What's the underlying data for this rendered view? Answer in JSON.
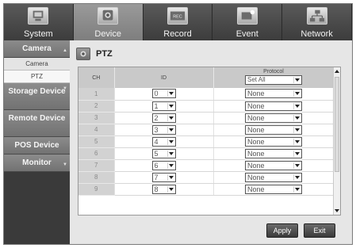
{
  "tabs": [
    {
      "label": "System",
      "icon": "system-icon",
      "active": false
    },
    {
      "label": "Device",
      "icon": "device-icon",
      "active": true
    },
    {
      "label": "Record",
      "icon": "record-icon",
      "active": false
    },
    {
      "label": "Event",
      "icon": "event-icon",
      "active": false
    },
    {
      "label": "Network",
      "icon": "network-icon",
      "active": false
    }
  ],
  "record_icon_text": "REC",
  "sidebar": {
    "camera": "Camera",
    "sub_camera": "Camera",
    "sub_ptz": "PTZ",
    "storage": "Storage Device",
    "remote": "Remote Device",
    "pos": "POS Device",
    "monitor": "Monitor"
  },
  "page": {
    "title": "PTZ",
    "title_icon": "ptz-camera-icon"
  },
  "table": {
    "headers": {
      "ch": "CH",
      "id": "ID",
      "protocol": "Protocol"
    },
    "protocol_all": "Set All",
    "rows": [
      {
        "ch": "1",
        "id": "0",
        "protocol": "None"
      },
      {
        "ch": "2",
        "id": "1",
        "protocol": "None"
      },
      {
        "ch": "3",
        "id": "2",
        "protocol": "None"
      },
      {
        "ch": "4",
        "id": "3",
        "protocol": "None"
      },
      {
        "ch": "5",
        "id": "4",
        "protocol": "None"
      },
      {
        "ch": "6",
        "id": "5",
        "protocol": "None"
      },
      {
        "ch": "7",
        "id": "6",
        "protocol": "None"
      },
      {
        "ch": "8",
        "id": "7",
        "protocol": "None"
      },
      {
        "ch": "9",
        "id": "8",
        "protocol": "None"
      }
    ]
  },
  "buttons": {
    "apply": "Apply",
    "exit": "Exit"
  }
}
